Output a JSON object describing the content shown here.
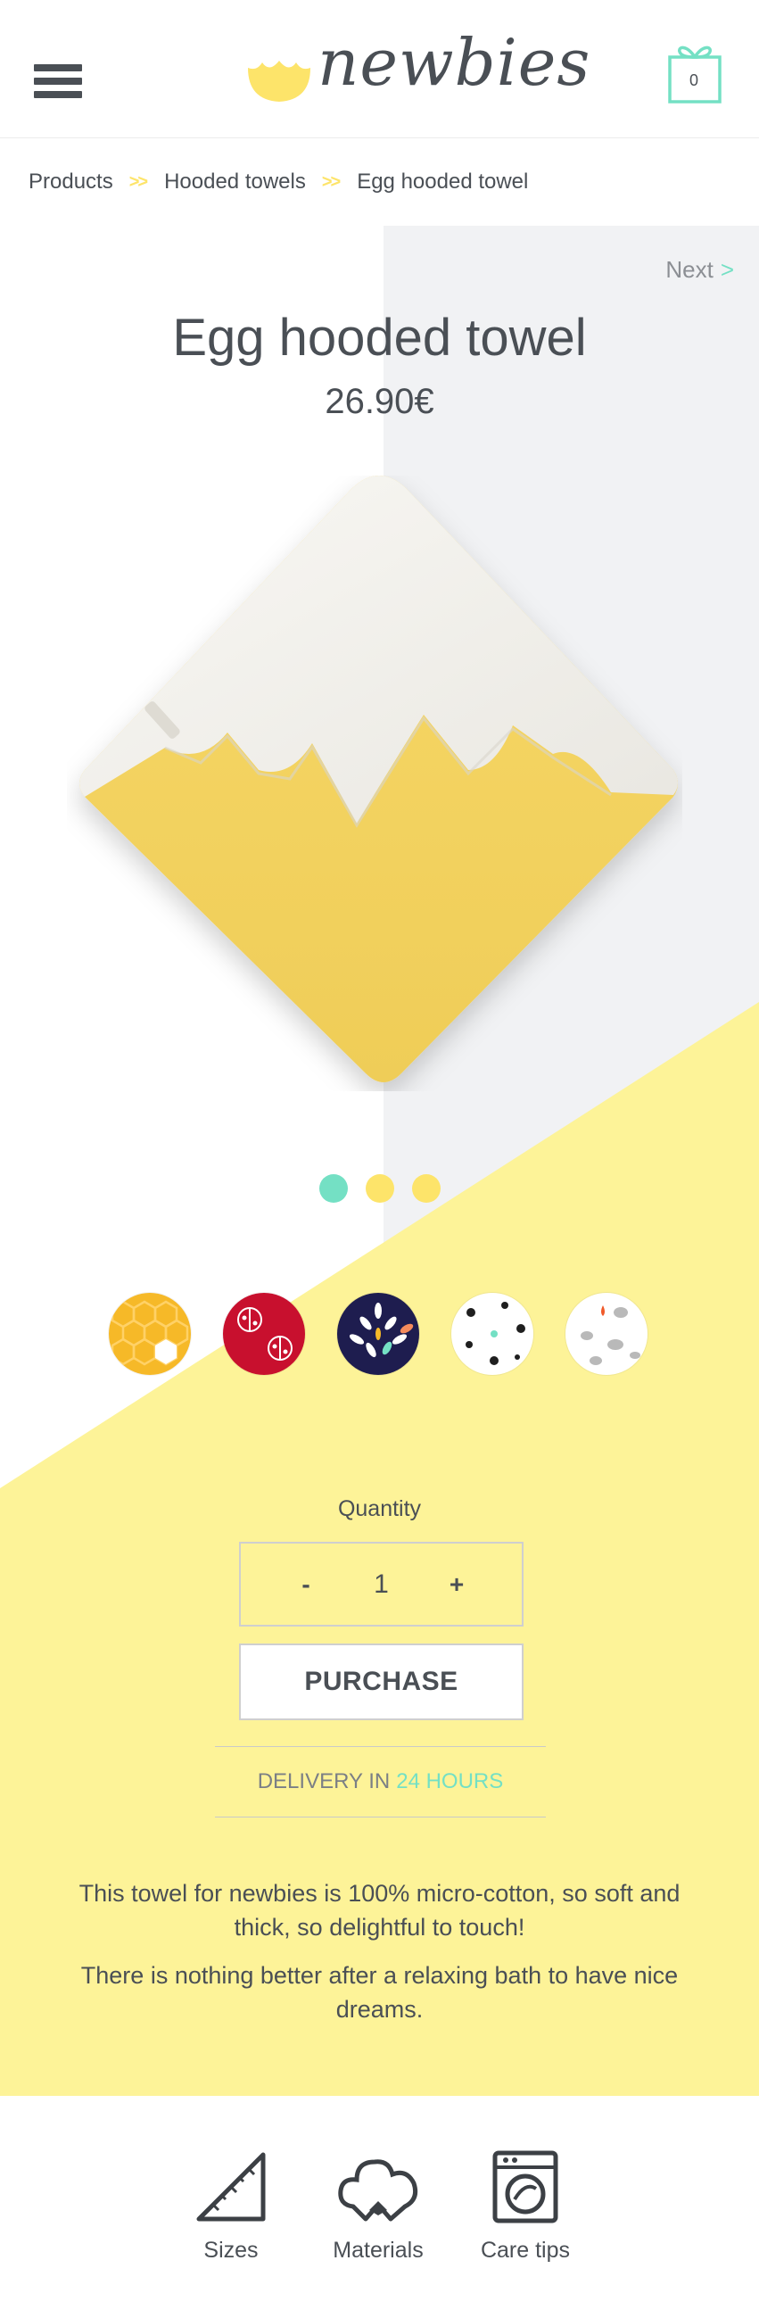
{
  "header": {
    "logo_text": "newbies",
    "cart_count": "0"
  },
  "breadcrumb": {
    "items": [
      "Products",
      "Hooded towels",
      "Egg hooded towel"
    ],
    "separator": ">>"
  },
  "product": {
    "next_label": "Next",
    "next_arrow": ">",
    "title": "Egg hooded towel",
    "price": "26.90€",
    "carousel_dots": 3,
    "active_dot": 0,
    "swatches": [
      "honeycomb",
      "red-ladybug",
      "navy-leaves",
      "white-dots",
      "white-drops"
    ]
  },
  "purchase": {
    "quantity_label": "Quantity",
    "minus_label": "-",
    "quantity_value": "1",
    "plus_label": "+",
    "purchase_label": "PURCHASE",
    "delivery_prefix": "DELIVERY IN",
    "delivery_highlight": "24 HOURS"
  },
  "description": {
    "p1": "This towel for newbies is 100% micro-cotton, so soft and thick, so delightful to touch!",
    "p2": "There is nothing better after a relaxing bath to have nice dreams."
  },
  "footer": {
    "sizes": "Sizes",
    "materials": "Materials",
    "care": "Care tips"
  },
  "colors": {
    "accent": "#74e0c4",
    "yellow": "#fdf398",
    "text": "#4a4f55"
  }
}
